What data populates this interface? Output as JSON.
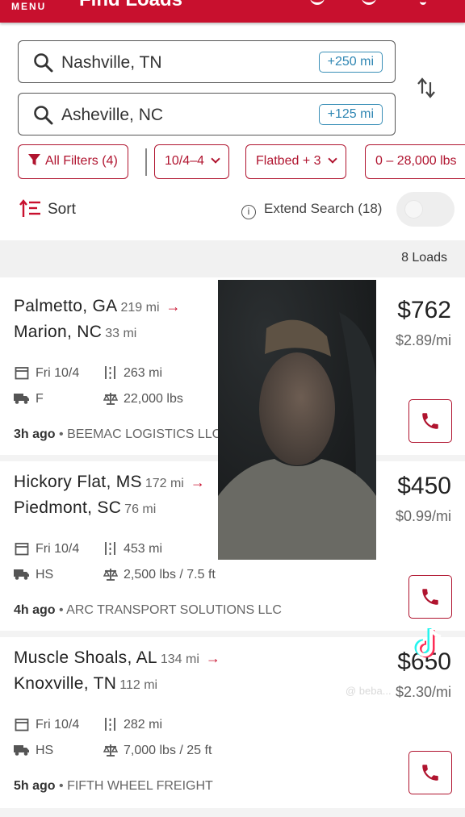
{
  "header": {
    "menu_label": "MENU",
    "title": "Find Loads"
  },
  "search": {
    "origin": {
      "value": "Nashville, TN",
      "radius": "+250 mi"
    },
    "destination": {
      "value": "Asheville, NC",
      "radius": "+125 mi"
    }
  },
  "filters": {
    "all_filters": "All Filters (4)",
    "date": "10/4–4",
    "equipment": "Flatbed + 3",
    "weight": "0 – 28,000 lbs"
  },
  "sort_label": "Sort",
  "extend_search": {
    "label": "Extend Search (18)",
    "enabled": false
  },
  "loads_count": "8 Loads",
  "loads": [
    {
      "origin": "Palmetto, GA",
      "origin_deadhead": "219 mi",
      "destination": "Marion, NC",
      "destination_deadhead": "33 mi",
      "date": "Fri 10/4",
      "distance": "263 mi",
      "equipment": "F",
      "weight": "22,000 lbs",
      "price": "$762",
      "rate": "$2.89/mi",
      "age": "3h ago",
      "broker": "BEEMAC LOGISTICS LLC"
    },
    {
      "origin": "Hickory Flat, MS",
      "origin_deadhead": "172 mi",
      "destination": "Piedmont, SC",
      "destination_deadhead": "76 mi",
      "date": "Fri 10/4",
      "distance": "453 mi",
      "equipment": "HS",
      "weight": "2,500 lbs / 7.5 ft",
      "price": "$450",
      "rate": "$0.99/mi",
      "age": "4h ago",
      "broker": "ARC TRANSPORT SOLUTIONS LLC"
    },
    {
      "origin": "Muscle Shoals, AL",
      "origin_deadhead": "134 mi",
      "destination": "Knoxville, TN",
      "destination_deadhead": "112 mi",
      "date": "Fri 10/4",
      "distance": "282 mi",
      "equipment": "HS",
      "weight": "7,000 lbs / 25 ft",
      "price": "$650",
      "rate": "$2.30/mi",
      "age": "5h ago",
      "broker": "FIFTH WHEEL FREIGHT"
    }
  ],
  "overlay": {
    "watermark_text": "@ beba..."
  },
  "colors": {
    "brand": "#c8102e",
    "accent_blue": "#2f86b3",
    "muted_bg": "#f1f1f1"
  },
  "icons": {
    "search": "search-icon",
    "swap": "swap-icon",
    "filter": "funnel-icon",
    "sort": "sort-icon",
    "info": "info-icon",
    "calendar": "calendar-icon",
    "distance": "distance-icon",
    "truck": "truck-icon",
    "weight": "scale-icon",
    "phone": "phone-icon"
  }
}
